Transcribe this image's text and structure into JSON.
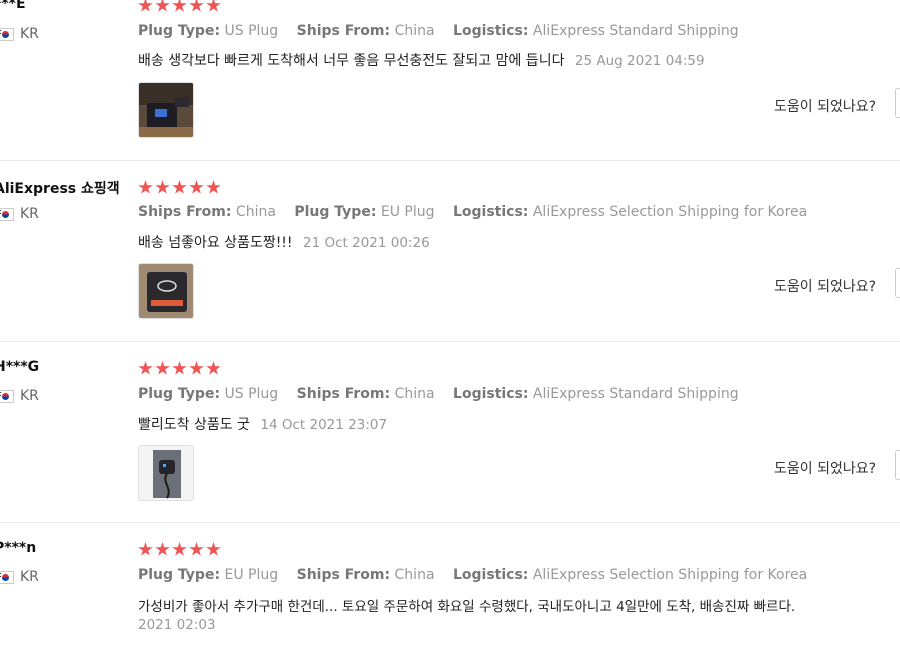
{
  "labels": {
    "plug_type": "Plug Type:",
    "ships_from": "Ships From:",
    "logistics": "Logistics:",
    "helpful": "도움이 되었나요?"
  },
  "colors": {
    "star": "#f05454",
    "muted": "#999999"
  },
  "reviews": [
    {
      "user": "***E",
      "country": "KR",
      "rating": 5,
      "prop1_key": "Plug Type:",
      "prop1_val": "US Plug",
      "prop2_key": "Ships From:",
      "prop2_val": "China",
      "prop3_key": "Logistics:",
      "prop3_val": "AliExpress Standard Shipping",
      "text": "배송 생각보다 빠르게 도착해서 너무 좋음 무선충전도 잘되고 맘에 듭니다",
      "date": "25 Aug 2021 04:59"
    },
    {
      "user": "AliExpress 쇼핑객",
      "country": "KR",
      "rating": 5,
      "prop1_key": "Ships From:",
      "prop1_val": "China",
      "prop2_key": "Plug Type:",
      "prop2_val": "EU Plug",
      "prop3_key": "Logistics:",
      "prop3_val": "AliExpress Selection Shipping for Korea",
      "text": "배송 넘좋아요 상품도짱!!!",
      "date": "21 Oct 2021 00:26"
    },
    {
      "user": "H***G",
      "country": "KR",
      "rating": 5,
      "prop1_key": "Plug Type:",
      "prop1_val": "US Plug",
      "prop2_key": "Ships From:",
      "prop2_val": "China",
      "prop3_key": "Logistics:",
      "prop3_val": "AliExpress Standard Shipping",
      "text": "빨리도착 상품도 굿",
      "date": "14 Oct 2021 23:07"
    },
    {
      "user": "P***n",
      "country": "KR",
      "rating": 5,
      "prop1_key": "Plug Type:",
      "prop1_val": "EU Plug",
      "prop2_key": "Ships From:",
      "prop2_val": "China",
      "prop3_key": "Logistics:",
      "prop3_val": "AliExpress Selection Shipping for Korea",
      "text": "가성비가 좋아서 추가구매 한건데... 토요일 주문하여 화요일 수령했다, 국내도아니고 4일만에 도착, 배송진짜 빠르다.",
      "date": "2021 02:03"
    }
  ]
}
